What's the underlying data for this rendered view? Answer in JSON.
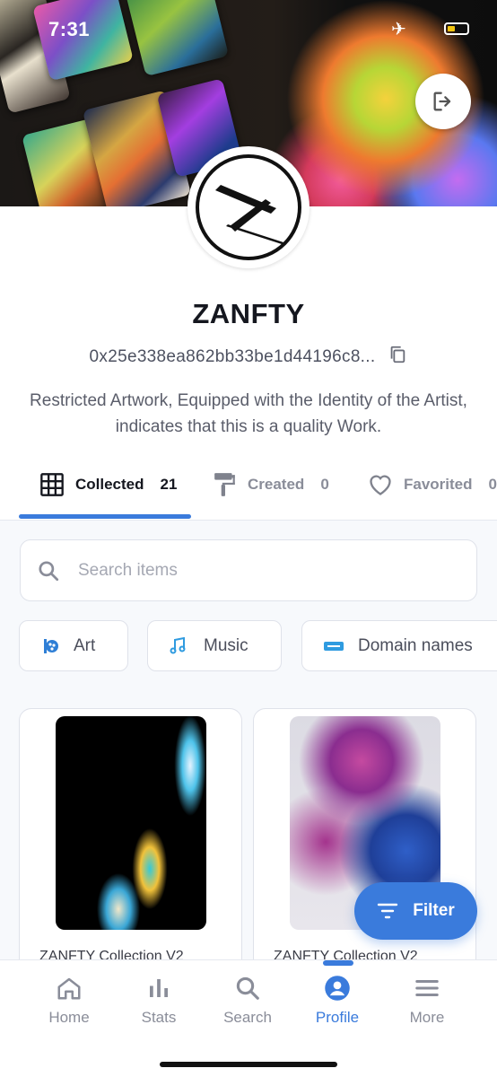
{
  "status_bar": {
    "time": "7:31"
  },
  "profile": {
    "name": "ZANFTY",
    "wallet_address": "0x25e338ea862bb33be1d44196c8...",
    "bio": "Restricted Artwork, Equipped with the Identity of the Artist, indicates that this is a quality Work."
  },
  "tabs": [
    {
      "label": "Collected",
      "count": "21",
      "icon": "grid-icon",
      "active": true
    },
    {
      "label": "Created",
      "count": "0",
      "icon": "paint-roller-icon",
      "active": false
    },
    {
      "label": "Favorited",
      "count": "0",
      "icon": "heart-icon",
      "active": false
    }
  ],
  "search": {
    "placeholder": "Search items"
  },
  "categories": [
    {
      "label": "Art",
      "icon": "art-icon"
    },
    {
      "label": "Music",
      "icon": "music-icon"
    },
    {
      "label": "Domain names",
      "icon": "domain-icon"
    }
  ],
  "items": [
    {
      "title": "ZANFTY Collection V2"
    },
    {
      "title": "ZANFTY Collection V2"
    }
  ],
  "filter": {
    "label": "Filter"
  },
  "nav": [
    {
      "label": "Home",
      "icon": "home-icon"
    },
    {
      "label": "Stats",
      "icon": "stats-icon"
    },
    {
      "label": "Search",
      "icon": "search-icon"
    },
    {
      "label": "Profile",
      "icon": "profile-icon",
      "active": true
    },
    {
      "label": "More",
      "icon": "menu-icon"
    }
  ],
  "colors": {
    "accent": "#3a7bdc",
    "text": "#15171f",
    "muted": "#8a8d99"
  }
}
